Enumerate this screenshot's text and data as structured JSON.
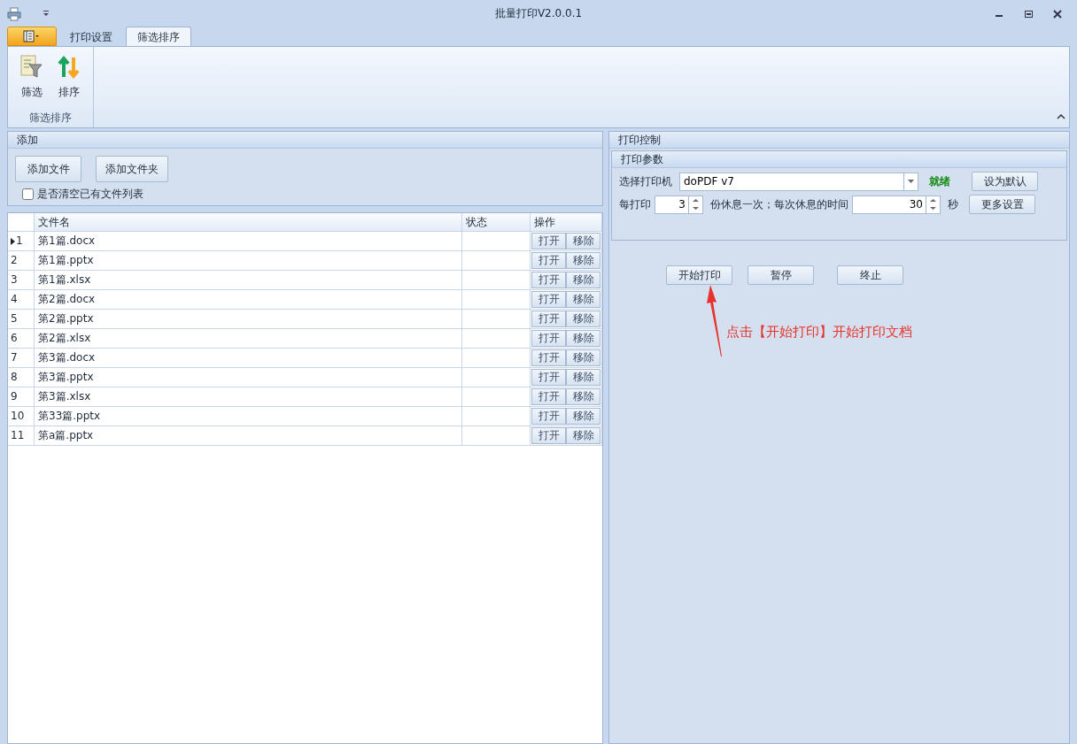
{
  "window": {
    "title": "批量打印V2.0.0.1"
  },
  "ribbon": {
    "tabs": [
      {
        "label": "打印设置",
        "selected": false
      },
      {
        "label": "筛选排序",
        "selected": true
      }
    ],
    "buttons": [
      {
        "label": "筛选",
        "kind": "filter"
      },
      {
        "label": "排序",
        "kind": "sort"
      }
    ],
    "group_label": "筛选排序"
  },
  "add_panel": {
    "title": "添加",
    "buttons": [
      "添加文件",
      "添加文件夹"
    ],
    "clear_checkbox": {
      "label": "是否清空已有文件列表",
      "checked": false
    }
  },
  "table": {
    "columns": [
      "文件名",
      "状态",
      "操作"
    ],
    "rows": [
      {
        "number": "1",
        "file": "第1篇.docx",
        "selected": true,
        "actions": [
          "打开",
          "移除"
        ]
      },
      {
        "number": "2",
        "file": "第1篇.pptx",
        "selected": false,
        "actions": [
          "打开",
          "移除"
        ]
      },
      {
        "number": "3",
        "file": "第1篇.xlsx",
        "selected": false,
        "actions": [
          "打开",
          "移除"
        ]
      },
      {
        "number": "4",
        "file": "第2篇.docx",
        "selected": false,
        "actions": [
          "打开",
          "移除"
        ]
      },
      {
        "number": "5",
        "file": "第2篇.pptx",
        "selected": false,
        "actions": [
          "打开",
          "移除"
        ]
      },
      {
        "number": "6",
        "file": "第2篇.xlsx",
        "selected": false,
        "actions": [
          "打开",
          "移除"
        ]
      },
      {
        "number": "7",
        "file": "第3篇.docx",
        "selected": false,
        "actions": [
          "打开",
          "移除"
        ]
      },
      {
        "number": "8",
        "file": "第3篇.pptx",
        "selected": false,
        "actions": [
          "打开",
          "移除"
        ]
      },
      {
        "number": "9",
        "file": "第3篇.xlsx",
        "selected": false,
        "actions": [
          "打开",
          "移除"
        ]
      },
      {
        "number": "10",
        "file": "第33篇.pptx",
        "selected": false,
        "actions": [
          "打开",
          "移除"
        ]
      },
      {
        "number": "11",
        "file": "第a篇.pptx",
        "selected": false,
        "actions": [
          "打开",
          "移除"
        ]
      }
    ]
  },
  "print_control": {
    "title": "打印控制",
    "params": {
      "title": "打印参数",
      "printer_label": "选择打印机",
      "printer": "doPDF v7",
      "printer_status": "就绪",
      "set_default": "设为默认",
      "every_label": "每打印",
      "every_value": "3",
      "rest_label": "份休息一次；每次休息的时间",
      "rest_value": "30",
      "seconds_label": "秒",
      "more_settings": "更多设置"
    },
    "buttons": [
      "开始打印",
      "暂停",
      "终止"
    ]
  },
  "annotation": {
    "text": "点击【开始打印】开始打印文档"
  }
}
